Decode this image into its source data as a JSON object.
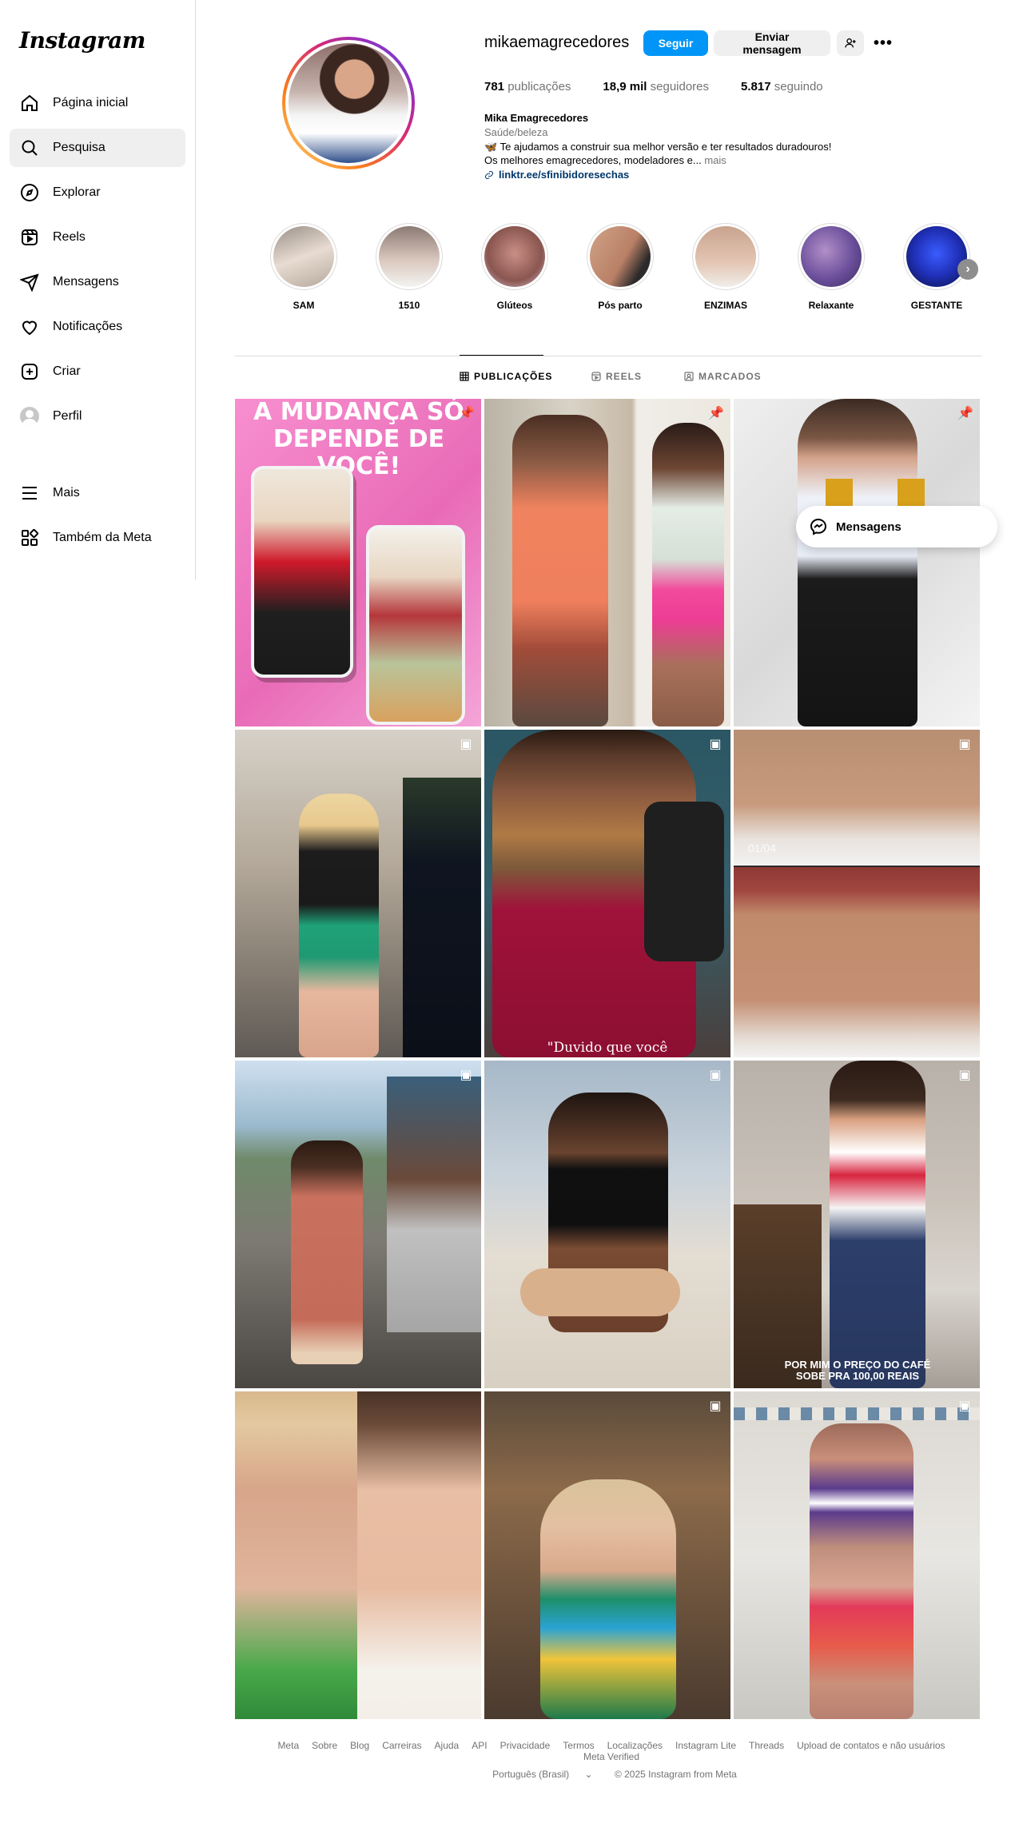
{
  "app": {
    "logo": "Instagram"
  },
  "sidebar": {
    "items": [
      {
        "label": "Página inicial",
        "icon": "home-icon"
      },
      {
        "label": "Pesquisa",
        "icon": "search-icon"
      },
      {
        "label": "Explorar",
        "icon": "compass-icon"
      },
      {
        "label": "Reels",
        "icon": "reels-icon"
      },
      {
        "label": "Mensagens",
        "icon": "send-icon"
      },
      {
        "label": "Notificações",
        "icon": "heart-icon"
      },
      {
        "label": "Criar",
        "icon": "plus-square-icon"
      },
      {
        "label": "Perfil",
        "icon": "avatar"
      }
    ],
    "more": "Mais",
    "meta": "Também da Meta"
  },
  "profile": {
    "username": "mikaemagrecedores",
    "follow_label": "Seguir",
    "message_label": "Enviar mensagem",
    "stats": {
      "posts_count": "781",
      "posts_label": "publicações",
      "followers_count": "18,9 mil",
      "followers_label": "seguidores",
      "following_count": "5.817",
      "following_label": "seguindo"
    },
    "full_name": "Mika Emagrecedores",
    "category": "Saúde/beleza",
    "bio_line1": "🦋 Te ajudamos a construir sua melhor versão e ter resultados duradouros!",
    "bio_line2": "Os melhores emagrecedores, modeladores e...",
    "bio_more": "mais",
    "link": "linktr.ee/sfinibidoresechas"
  },
  "highlights": [
    {
      "label": "SAM"
    },
    {
      "label": "1510"
    },
    {
      "label": "Glúteos"
    },
    {
      "label": "Pós parto"
    },
    {
      "label": "ENZIMAS"
    },
    {
      "label": "Relaxante"
    },
    {
      "label": "GESTANTE"
    }
  ],
  "tabs": [
    {
      "label": "PUBLICAÇÕES"
    },
    {
      "label": "REELS"
    },
    {
      "label": "MARCADOS"
    }
  ],
  "posts": {
    "p1_text": "A MUDANÇA SÓ DEPENDE DE VOCÊ!",
    "p6_text": "01/04",
    "p5_text": "\"Duvido que você",
    "p9_text": "POR MIM O PREÇO DO CAFÉ SOBE PRA 100,00 REAIS"
  },
  "floating_messages": "Mensagens",
  "footer": {
    "links": [
      "Meta",
      "Sobre",
      "Blog",
      "Carreiras",
      "Ajuda",
      "API",
      "Privacidade",
      "Termos",
      "Localizações",
      "Instagram Lite",
      "Threads",
      "Upload de contatos e não usuários",
      "Meta Verified"
    ],
    "language": "Português (Brasil)",
    "copyright": "© 2025 Instagram from Meta"
  }
}
